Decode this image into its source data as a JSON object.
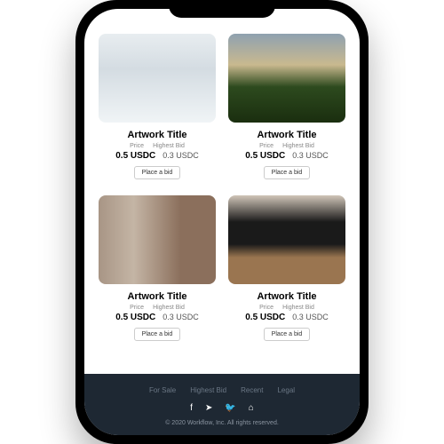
{
  "cards": [
    {
      "title": "Artwork Title",
      "priceLabel": "Price",
      "bidLabel": "Highest Bid",
      "price": "0.5 USDC",
      "bid": "0.3 USDC",
      "button": "Place a bid"
    },
    {
      "title": "Artwork Title",
      "priceLabel": "Price",
      "bidLabel": "Highest Bid",
      "price": "0.5 USDC",
      "bid": "0.3 USDC",
      "button": "Place a bid"
    },
    {
      "title": "Artwork Title",
      "priceLabel": "Price",
      "bidLabel": "Highest Bid",
      "price": "0.5 USDC",
      "bid": "0.3 USDC",
      "button": "Place a bid"
    },
    {
      "title": "Artwork Title",
      "priceLabel": "Price",
      "bidLabel": "Highest Bid",
      "price": "0.5 USDC",
      "bid": "0.3 USDC",
      "button": "Place a bid"
    }
  ],
  "footer": {
    "links": [
      "For Sale",
      "Highest Bid",
      "Recent",
      "Legal"
    ],
    "copy": "© 2020 Workflow, Inc. All rights reserved."
  },
  "icons": {
    "fb": "f",
    "tg": "➤",
    "tw": "🐦",
    "gh": "⌂"
  }
}
